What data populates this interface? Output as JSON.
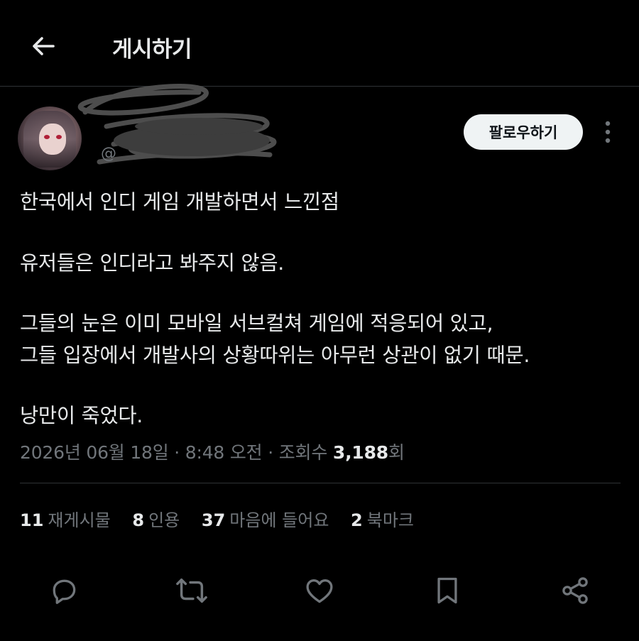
{
  "header": {
    "back_icon": "arrow-left-icon",
    "title": "게시하기"
  },
  "author": {
    "avatar": "avatar-image",
    "name_redacted": true,
    "handle_prefix": "@"
  },
  "follow_button": {
    "label": "팔로우하기"
  },
  "more_icon": "more-vertical-icon",
  "post": {
    "lines": [
      "한국에서 인디 게임 개발하면서 느낀점",
      "유저들은 인디라고 봐주지 않음.",
      "그들의 눈은 이미 모바일 서브컬쳐 게임에 적응되어 있고,",
      "그들 입장에서 개발사의 상황따위는 아무런 상관이 없기 때문.",
      "낭만이 죽었다."
    ]
  },
  "meta": {
    "date": "2026년 06월 18일",
    "separator": "·",
    "time": "8:48 오전",
    "views_label": "조회수",
    "views_count": "3,188",
    "views_suffix": "회"
  },
  "stats": [
    {
      "count": "11",
      "label": "재게시물"
    },
    {
      "count": "8",
      "label": "인용"
    },
    {
      "count": "37",
      "label": "마음에 들어요"
    },
    {
      "count": "2",
      "label": "북마크"
    }
  ],
  "actions": [
    "reply-icon",
    "repost-icon",
    "like-icon",
    "bookmark-icon",
    "share-icon"
  ],
  "colors": {
    "background": "#000000",
    "text_primary": "#e7e9ea",
    "text_secondary": "#71767b",
    "divider": "#2f3336",
    "follow_button_bg": "#eff3f4",
    "follow_button_text": "#0f1419"
  }
}
